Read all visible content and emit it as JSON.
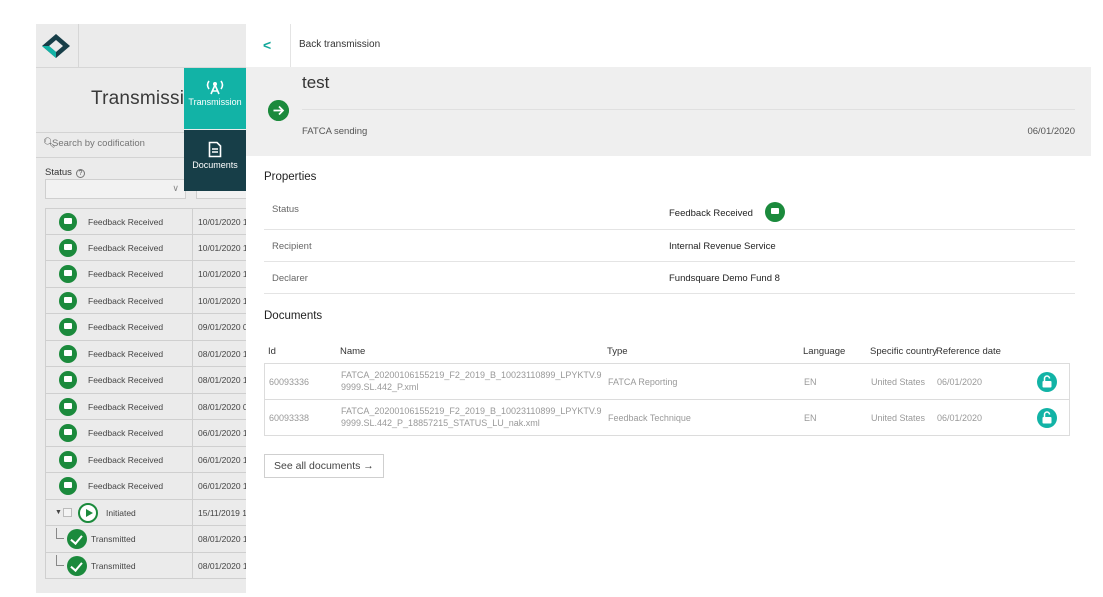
{
  "background": {
    "title": "Transmissic",
    "search_placeholder": "Search by codification",
    "status_label": "Status",
    "rows": [
      {
        "label": "Feedback Received",
        "date": "10/01/2020 1"
      },
      {
        "label": "Feedback Received",
        "date": "10/01/2020 1"
      },
      {
        "label": "Feedback Received",
        "date": "10/01/2020 1"
      },
      {
        "label": "Feedback Received",
        "date": "10/01/2020 1"
      },
      {
        "label": "Feedback Received",
        "date": "09/01/2020 0"
      },
      {
        "label": "Feedback Received",
        "date": "08/01/2020 1"
      },
      {
        "label": "Feedback Received",
        "date": "08/01/2020 1"
      },
      {
        "label": "Feedback Received",
        "date": "08/01/2020 0"
      },
      {
        "label": "Feedback Received",
        "date": "06/01/2020 1"
      },
      {
        "label": "Feedback Received",
        "date": "06/01/2020 1"
      },
      {
        "label": "Feedback Received",
        "date": "06/01/2020 1"
      }
    ],
    "initiated": {
      "label": "Initiated",
      "date": "15/11/2019 1"
    },
    "sub_rows": [
      {
        "label": "Transmitted",
        "date": "08/01/2020 1"
      },
      {
        "label": "Transmitted",
        "date": "08/01/2020 1"
      }
    ]
  },
  "tabs": {
    "transmission": "Transmission",
    "documents": "Documents"
  },
  "panel": {
    "back_label": "Back transmission",
    "title": "test",
    "type": "FATCA sending",
    "date": "06/01/2020"
  },
  "properties": {
    "title": "Properties",
    "status_key": "Status",
    "status_value": "Feedback Received",
    "recipient_key": "Recipient",
    "recipient_value": "Internal Revenue Service",
    "declarer_key": "Declarer",
    "declarer_value": "Fundsquare Demo Fund 8"
  },
  "documents": {
    "title": "Documents",
    "headers": {
      "id": "Id",
      "name": "Name",
      "type": "Type",
      "language": "Language",
      "country": "Specific country",
      "ref_date": "Reference date"
    },
    "rows": [
      {
        "id": "60093336",
        "name": "FATCA_20200106155219_F2_2019_B_10023110899_LPYKTV.99999.SL.442_P.xml",
        "type": "FATCA Reporting",
        "language": "EN",
        "country": "United States",
        "ref_date": "06/01/2020"
      },
      {
        "id": "60093338",
        "name": "FATCA_20200106155219_F2_2019_B_10023110899_LPYKTV.99999.SL.442_P_18857215_STATUS_LU_nak.xml",
        "type": "Feedback Technique",
        "language": "EN",
        "country": "United States",
        "ref_date": "06/01/2020"
      }
    ],
    "see_all": "See all documents →"
  },
  "colors": {
    "accent_teal": "#12b3a6",
    "dark_tab": "#173e48",
    "status_green": "#1b8a3c"
  }
}
